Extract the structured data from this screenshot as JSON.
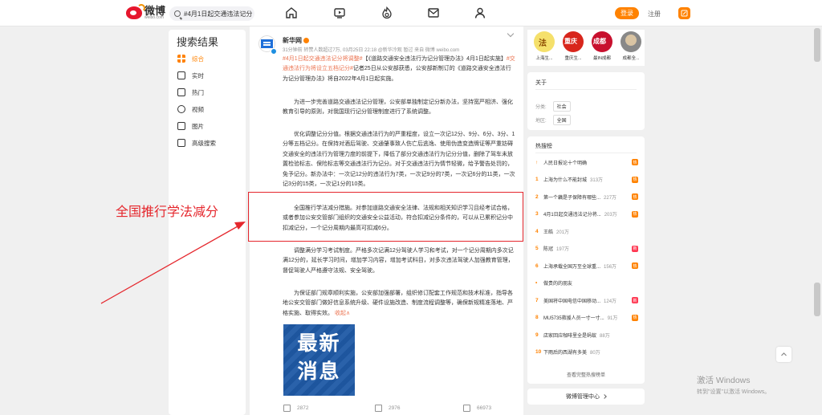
{
  "header": {
    "logo_text": "微博",
    "logo_sub": "weibo.com",
    "search_value": "#4月1日起交通违法记分",
    "login_label": "登录",
    "register_label": "注册"
  },
  "sidebar": {
    "title": "搜索结果",
    "items": [
      {
        "label": "综合",
        "active": true,
        "icon": "grid-icon"
      },
      {
        "label": "实时",
        "active": false,
        "icon": "clock-icon"
      },
      {
        "label": "热门",
        "active": false,
        "icon": "fire-icon"
      },
      {
        "label": "视频",
        "active": false,
        "icon": "video-icon"
      },
      {
        "label": "图片",
        "active": false,
        "icon": "image-icon"
      },
      {
        "label": "高级搜索",
        "active": false,
        "icon": "filter-icon"
      }
    ]
  },
  "post": {
    "author": "新华网",
    "meta": "31分钟前 转赞人数超过7万, 03月25日 22:18 @新华冷观 暂过 来自 微博 weibo.com",
    "p1_link1": "#4月1日起交通违法记分将调整#",
    "p1_text1": "【《道路交通安全违法行为记分管理办法》4月1日起实施】",
    "p1_link2": "#交通违法行为将设立五档记分#",
    "p1_text2": "记者25日从公安部获悉，公安部新制订的《道路交通安全违法行为记分管理办法》将自2022年4月1日起实施。",
    "p2": "为进一步完善道路交通违法记分管理，公安部单独制定记分新办法，坚持宽严相济、强化教育引导的原则，对我国现行记分管理制度进行了系统调整。",
    "p3": "优化调整记分分值。根据交通违法行为的严重程度，设立一次记12分、9分、6分、3分、1分等五档记分。在保持对酒后驾驶、交通肇事致人伤亡后逃逸、使用伪造变造牌证等严重妨碍交通安全的违法行为管理力度的前提下，降低了部分交通违法行为记分分值，删除了驾车未放置检验标志、保险标志等交通违法行为记分。对于交通违法行为情节轻微，给予警告处罚的，免予记分。新办法中：一次记12分的违法行为7类，一次记9分的7类，一次记6分的11类，一次记3分的15类，一次记1分的10类。",
    "p4": "全国推行学法减分措施。对参加道路交通安全法律、法规和相关知识学习且经考试合格，或者参加公安交管部门组织的交通安全公益活动，符合扣减记分条件的，可以从已累积记分中扣减记分，一个记分周期内最高可扣减6分。",
    "p5": "调整满分学习考试制度。严格多次记满12分驾驶人学习和考试，对一个记分周期内多次记满12分的，延长学习时间，增加学习内容，增加考试科目，对多次违法驾驶人加强教育管理，督促驾驶人严格遵守法规、安全驾驶。",
    "p6": "为保证部门规章顺利实施，公安部加强部署，组织修订配套工作规范和技术标准，指导各地公安交管部门做好信息系统升级、硬件设施改造、制度流程调整等，确保新规精准落地、严格实施、取得实效。",
    "collapse_label": "收起∧",
    "image_text_line1": "最新",
    "image_text_line2": "消息",
    "image_caption": "",
    "repost_count": "2872",
    "comment_count": "2976",
    "like_count": "66973"
  },
  "annotation": {
    "label": "全国推行学法减分",
    "color": "#e5272d"
  },
  "right": {
    "avatars": [
      {
        "label": "上海生...",
        "bg": "#f5e06b",
        "text": "法"
      },
      {
        "label": "重庆生...",
        "bg": "#d8261c",
        "text": "重庆"
      },
      {
        "label": "最IN成都",
        "bg": "#c8102e",
        "text": "成都"
      },
      {
        "label": "成都全...",
        "bg": "#888888",
        "text": ""
      }
    ],
    "about": {
      "title": "关于",
      "category_label": "分类:",
      "category_value": "社会",
      "region_label": "地区:",
      "region_value": "全国"
    },
    "hot": {
      "title": "热搜榜",
      "items": [
        {
          "rank": "↑",
          "text": "人民日报论十个明确",
          "heat": "",
          "badge": "热",
          "badge_color": "#ff8200"
        },
        {
          "rank": "1",
          "text": "上海为什么不能封城",
          "heat": "313万",
          "badge": "热",
          "badge_color": "#ff8200"
        },
        {
          "rank": "2",
          "text": "第一个藕是子保障有哪些...",
          "heat": "227万",
          "badge": "热",
          "badge_color": "#ff8200"
        },
        {
          "rank": "3",
          "text": "4月1日起交通违法记分将...",
          "heat": "203万",
          "badge": "热",
          "badge_color": "#ff8200"
        },
        {
          "rank": "4",
          "text": "王皓",
          "heat": "201万",
          "badge": "",
          "badge_color": ""
        },
        {
          "rank": "5",
          "text": "陈冠",
          "heat": "197万",
          "badge": "新",
          "badge_color": "#ff3852"
        },
        {
          "rank": "6",
          "text": "上海承载全国万至全球重...",
          "heat": "156万",
          "badge": "热",
          "badge_color": "#ff8200"
        },
        {
          "rank": "•",
          "text": "做贵的的朋友",
          "heat": "",
          "badge": "",
          "badge_color": ""
        },
        {
          "rank": "7",
          "text": "美国将中国电信中国移动...",
          "heat": "124万",
          "badge": "新",
          "badge_color": "#ff3852"
        },
        {
          "rank": "8",
          "text": "MU5735救援人员一寸一寸...",
          "heat": "91万",
          "badge": "热",
          "badge_color": "#ff8200"
        },
        {
          "rank": "9",
          "text": "店家回应咖啡里全是蚂蚁",
          "heat": "88万",
          "badge": "",
          "badge_color": ""
        },
        {
          "rank": "10",
          "text": "下雨后的西湖有多美",
          "heat": "80万",
          "badge": "",
          "badge_color": ""
        }
      ],
      "more_label": "查看完整热搜榜单"
    },
    "mgmt_label": "微博管理中心"
  },
  "watermark": {
    "line1": "激活 Windows",
    "line2": "转到\"设置\"以激活 Windows。"
  }
}
